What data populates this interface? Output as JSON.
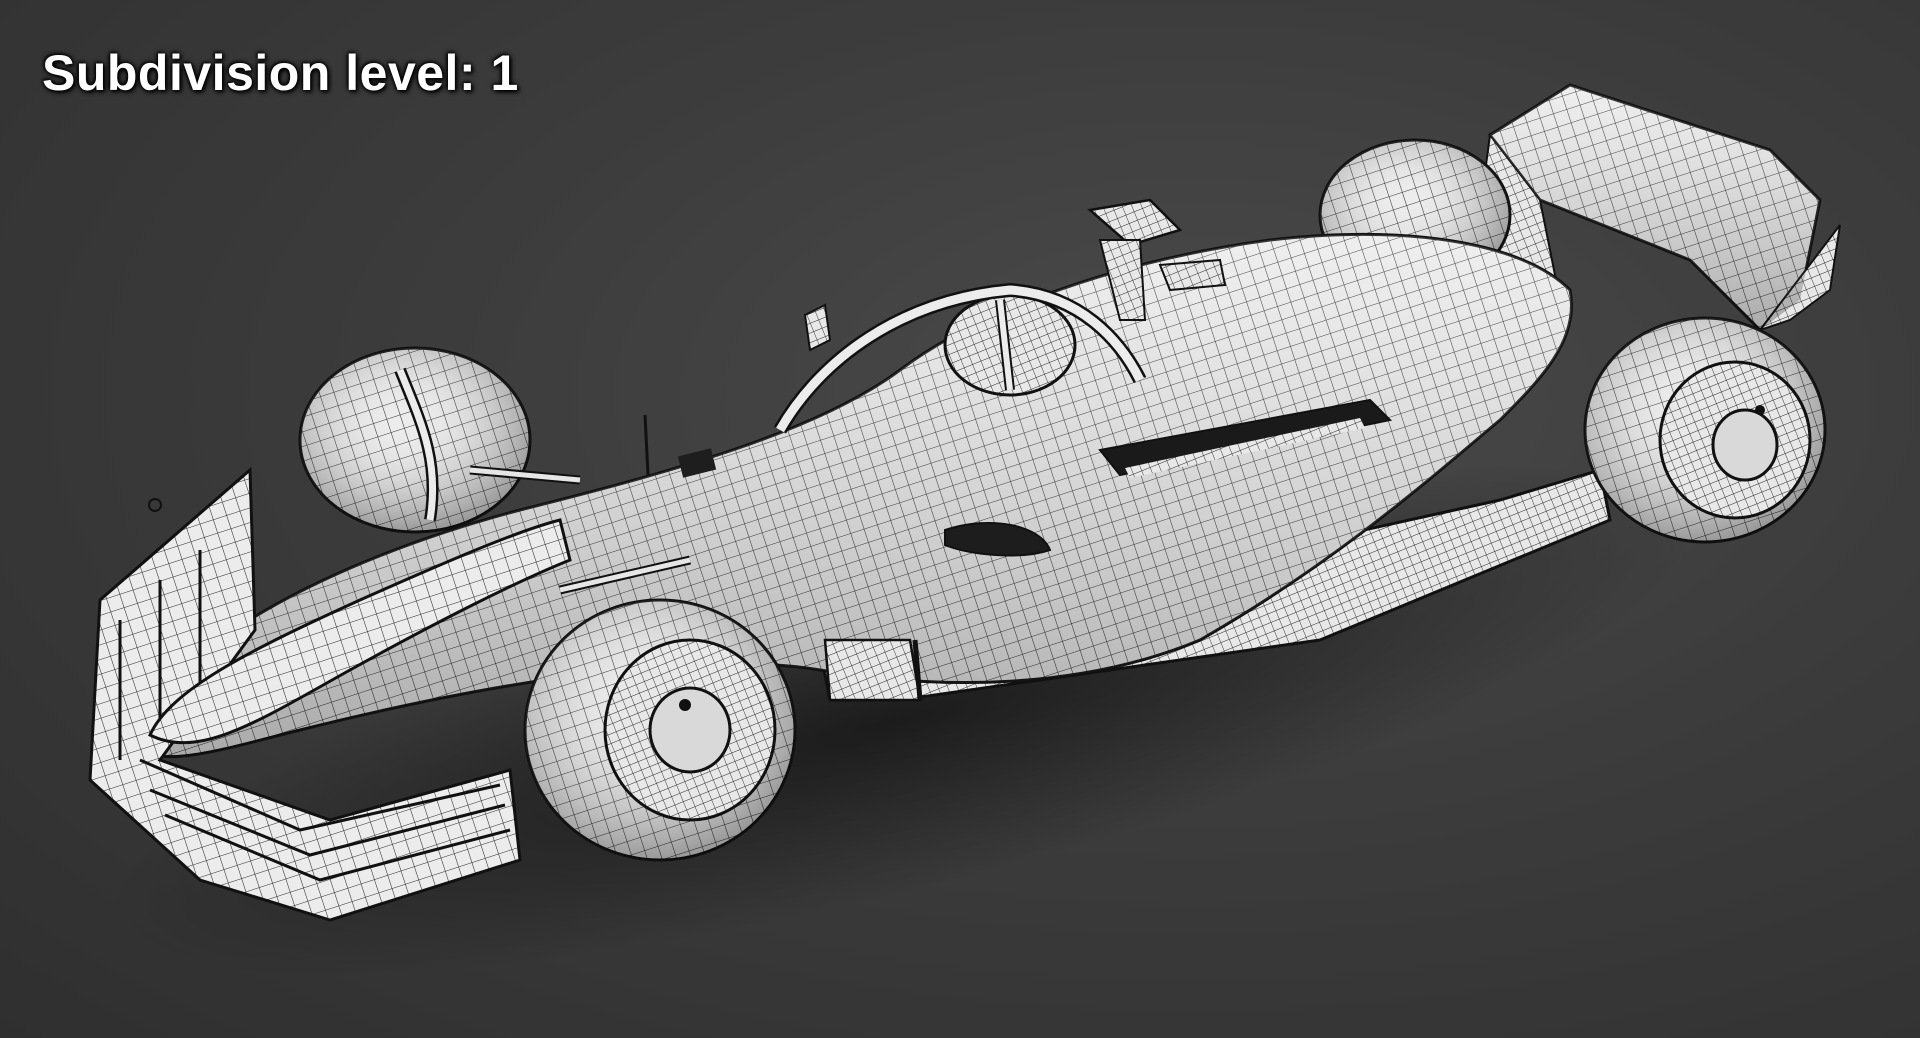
{
  "overlay": {
    "label": "Subdivision level: 1"
  },
  "scene": {
    "subject": "f1-car-wireframe-model",
    "mesh_color": "#ececec",
    "wire_color": "#1e1e1e",
    "background_color": "#3a3a3a"
  }
}
